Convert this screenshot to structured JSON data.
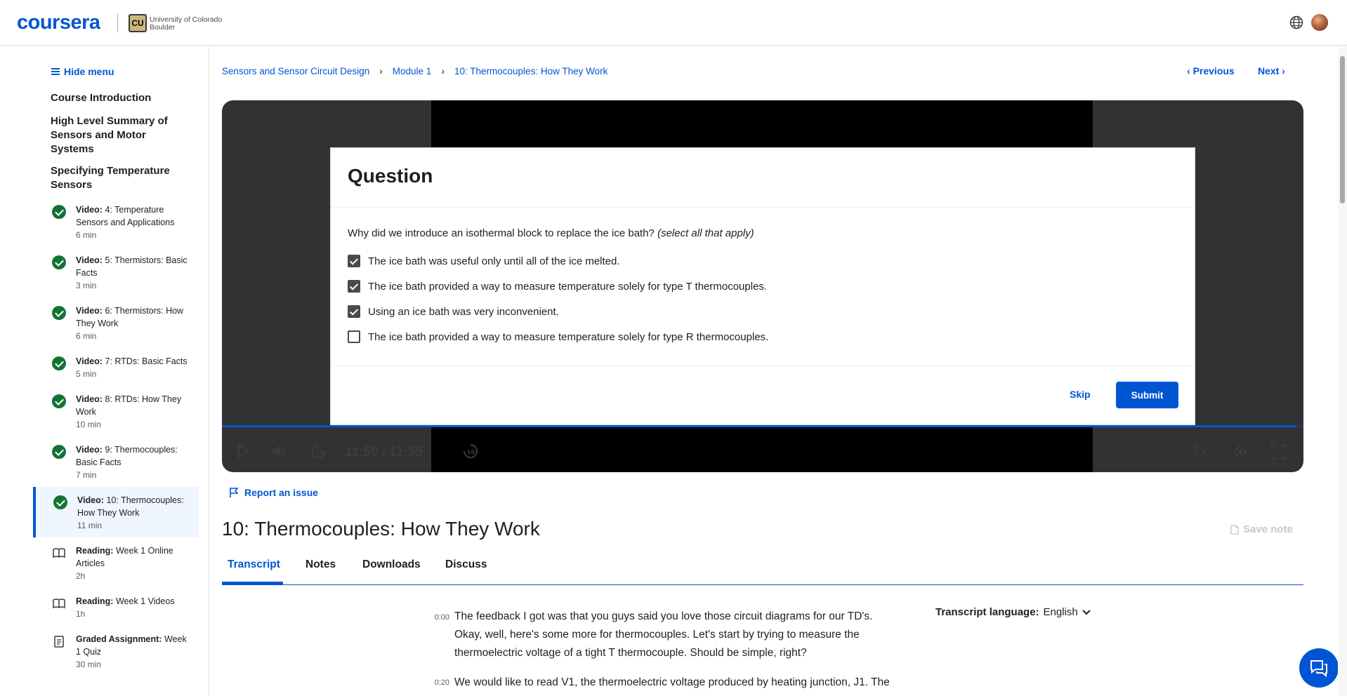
{
  "header": {
    "logo": "coursera",
    "partner_line1": "University of Colorado",
    "partner_line2": "Boulder",
    "partner_seal": "CU",
    "icons": [
      "globe-icon",
      "avatar"
    ]
  },
  "sidebar": {
    "hide_menu": "Hide menu",
    "sections": [
      "Course Introduction",
      "High Level Summary of Sensors and Motor Systems",
      "Specifying Temperature Sensors"
    ],
    "items": [
      {
        "kind": "Video:",
        "title": "4: Temperature Sensors and Applications",
        "duration": "6 min",
        "icon": "check-circle-icon"
      },
      {
        "kind": "Video:",
        "title": "5: Thermistors: Basic Facts",
        "duration": "3 min",
        "icon": "check-circle-icon"
      },
      {
        "kind": "Video:",
        "title": "6: Thermistors: How They Work",
        "duration": "6 min",
        "icon": "check-circle-icon"
      },
      {
        "kind": "Video:",
        "title": "7: RTDs: Basic Facts",
        "duration": "5 min",
        "icon": "check-circle-icon"
      },
      {
        "kind": "Video:",
        "title": "8: RTDs: How They Work",
        "duration": "10 min",
        "icon": "check-circle-icon"
      },
      {
        "kind": "Video:",
        "title": "9: Thermocouples: Basic Facts",
        "duration": "7 min",
        "icon": "check-circle-icon"
      },
      {
        "kind": "Video:",
        "title": "10: Thermocouples: How They Work",
        "duration": "11 min",
        "icon": "check-circle-icon"
      },
      {
        "kind": "Reading:",
        "title": "Week 1 Online Articles",
        "duration": "2h",
        "icon": "book-icon"
      },
      {
        "kind": "Reading:",
        "title": "Week 1 Videos",
        "duration": "1h",
        "icon": "book-icon"
      },
      {
        "kind": "Graded Assignment:",
        "title": "Week 1 Quiz",
        "duration": "30 min",
        "icon": "assignment-icon"
      }
    ]
  },
  "breadcrumb": [
    "Sensors and Sensor Circuit Design",
    "Module 1",
    "10: Thermocouples: How They Work"
  ],
  "nav": {
    "previous": "Previous",
    "next": "Next"
  },
  "video": {
    "time": "11:50 / 11:55",
    "speed": "1x",
    "progress": 0.993
  },
  "question": {
    "title": "Question",
    "prompt": "Why did we introduce an isothermal block to replace the ice bath?",
    "prompt_hint": "(select all that apply)",
    "options": [
      {
        "label": "The ice bath was useful only until all of the ice melted.",
        "checked": true
      },
      {
        "label": "The ice bath provided a way to measure temperature solely for type T thermocouples.",
        "checked": true
      },
      {
        "label": "Using an ice bath was very inconvenient.",
        "checked": true
      },
      {
        "label": "The ice bath provided a way to measure temperature solely for type R thermocouples.",
        "checked": false
      }
    ],
    "skip": "Skip",
    "submit": "Submit"
  },
  "report_issue": "Report an issue",
  "page_title": "10: Thermocouples: How They Work",
  "save_note": "Save note",
  "tabs": [
    "Transcript",
    "Notes",
    "Downloads",
    "Discuss"
  ],
  "transcript": {
    "language_label": "Transcript language:",
    "language": "English",
    "lines": [
      {
        "time": "0:00",
        "text": "The feedback I got was that you guys said you love those circuit diagrams for our TD's. Okay, well, here's some more for thermocouples. Let's start by trying to measure the thermoelectric voltage of a tight T thermocouple. Should be simple, right?"
      },
      {
        "time": "0:20",
        "text": "We would like to read V1, the thermoelectric voltage produced by heating junction, J1. The"
      }
    ]
  },
  "colors": {
    "brand": "#0056d2",
    "complete": "#137333"
  }
}
